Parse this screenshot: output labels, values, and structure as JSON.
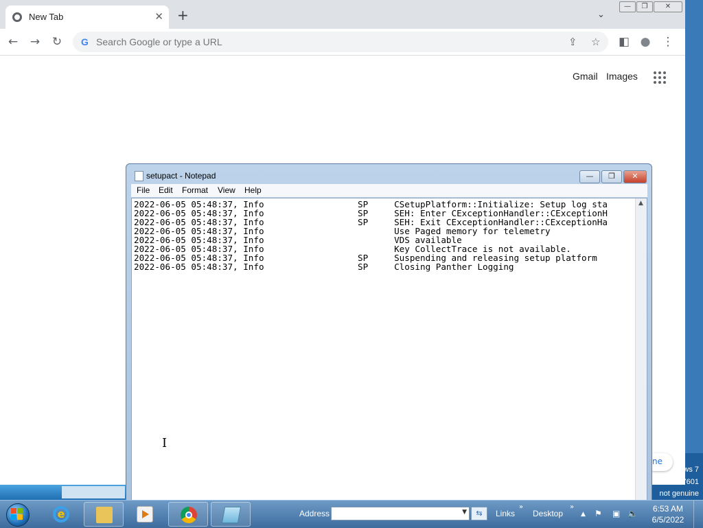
{
  "desktop": {
    "watermark_lines": [
      "ws 7",
      "7601",
      "not genuine"
    ]
  },
  "chrome": {
    "tab_title": "New Tab",
    "tab_close": "✕",
    "new_tab": "+",
    "tab_menu": "⌄",
    "window_buttons": [
      "—",
      "❐",
      "✕"
    ],
    "nav": {
      "back": "←",
      "forward": "→",
      "reload": "↻"
    },
    "omnibox_g": "G",
    "omnibox_placeholder": "Search Google or type a URL",
    "omnibox_icons": {
      "share": "⇪",
      "bookmark": "☆",
      "sidepanel": "◧",
      "profile": "●",
      "menu": "⋮"
    },
    "ntp_links": {
      "gmail": "Gmail",
      "images": "Images"
    },
    "customize_label": "ne"
  },
  "notepad": {
    "title": "setupact - Notepad",
    "buttons": {
      "minimize": "—",
      "maximize": "❐",
      "close": "✕"
    },
    "menu": [
      "File",
      "Edit",
      "Format",
      "View",
      "Help"
    ],
    "lines": [
      "2022-06-05 05:48:37, Info                  SP     CSetupPlatform::Initialize: Setup log sta",
      "2022-06-05 05:48:37, Info                  SP     SEH: Enter CExceptionHandler::CExceptionH",
      "2022-06-05 05:48:37, Info                  SP     SEH: Exit CExceptionHandler::CExceptionHa",
      "2022-06-05 05:48:37, Info                         Use Paged memory for telemetry",
      "2022-06-05 05:48:37, Info                         VDS available",
      "2022-06-05 05:48:37, Info                         Key CollectTrace is not available.",
      "2022-06-05 05:48:37, Info                  SP     Suspending and releasing setup platform",
      "2022-06-05 05:48:37, Info                  SP     Closing Panther Logging"
    ],
    "scroll_up": "▲"
  },
  "taskbar": {
    "address_label": "Address",
    "address_value": "",
    "address_drop": "▼",
    "address_go": "⇆",
    "links_label": "Links",
    "desktop_label": "Desktop",
    "chevron": "»",
    "tray_up": "▲",
    "time": "6:53 AM",
    "date": "6/5/2022"
  }
}
